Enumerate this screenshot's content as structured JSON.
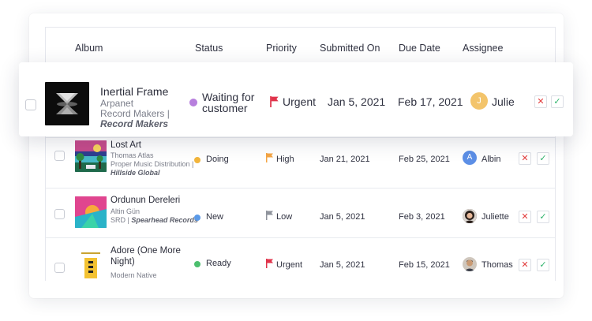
{
  "columns": {
    "album": "Album",
    "status": "Status",
    "priority": "Priority",
    "submitted": "Submitted On",
    "due": "Due Date",
    "assignee": "Assignee"
  },
  "highlighted": {
    "title": "Inertial Frame",
    "artist": "Arpanet",
    "distributor": "Record Makers |",
    "label": "Record Makers",
    "status": "Waiting for customer",
    "status_color": "#b77fdd",
    "priority": "Urgent",
    "priority_color": "#e0344b",
    "submitted": "Jan 5, 2021",
    "due": "Feb 17, 2021",
    "assignee": "Julie",
    "assignee_initial": "J",
    "assignee_color": "#f3c46b"
  },
  "rows": [
    {
      "title": "Lost Art",
      "artist": "Thomas Atlas",
      "distributor": "Proper Music Distribution |",
      "label": "Hillside Global",
      "status": "Doing",
      "status_color": "#f2b53c",
      "priority": "High",
      "priority_color": "#f4a544",
      "submitted": "Jan 21, 2021",
      "due": "Feb 25, 2021",
      "assignee": "Albin",
      "assignee_initial": "A",
      "assignee_color": "#5c8fe6"
    },
    {
      "title": "Ordunun Dereleri",
      "artist": "Altin Gün",
      "distributor": "SRD |",
      "label": "Spearhead Records",
      "status": "New",
      "status_color": "#5b9ae8",
      "priority": "Low",
      "priority_color": "#8f939c",
      "submitted": "Jan 5, 2021",
      "due": "Feb 3, 2021",
      "assignee": "Juliette"
    },
    {
      "title": "Adore (One More Night)",
      "artist": "Modern Native",
      "status": "Ready",
      "status_color": "#4cbf6e",
      "priority": "Urgent",
      "priority_color": "#e0344b",
      "submitted": "Jan 5, 2021",
      "due": "Feb 15, 2021",
      "assignee": "Thomas"
    }
  ],
  "buttons": {
    "reject": "✕",
    "approve": "✓"
  }
}
